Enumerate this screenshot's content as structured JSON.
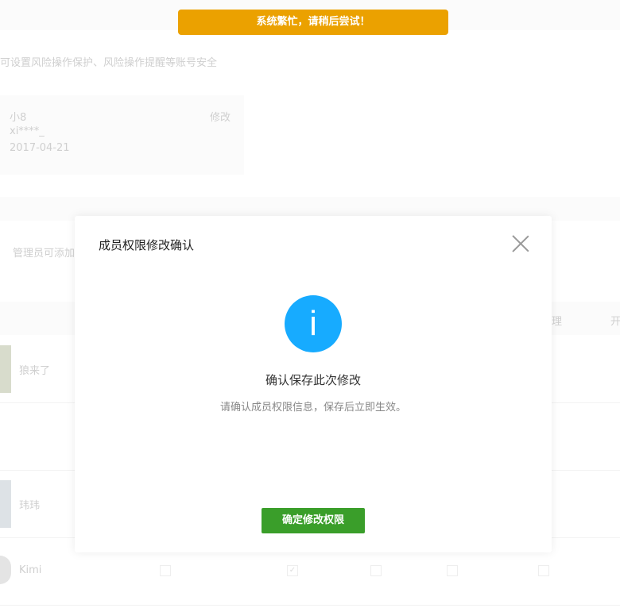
{
  "toast": {
    "message": "系统繁忙，请稍后尝试！",
    "color": "#eba100"
  },
  "background": {
    "security_desc": "可设置风险操作保护、风险操作提醒等账号安全",
    "account_card": {
      "name": "小8",
      "account": "xi****_",
      "date": "2017-04-21",
      "edit_label": "修改"
    },
    "members_desc": "管理员可添加",
    "table_headers": [
      "理",
      "开"
    ],
    "members": [
      {
        "name": "狼来了"
      },
      {
        "name": "玮玮"
      },
      {
        "name": "Kimi",
        "permissions": [
          false,
          true,
          false,
          false,
          false
        ]
      }
    ]
  },
  "modal": {
    "title": "成员权限修改确认",
    "icon": "info-icon",
    "headline": "确认保存此次修改",
    "message": "请确认成员权限信息，保存后立即生效。",
    "confirm_label": "确定修改权限",
    "confirm_color": "#3a9e2a",
    "icon_color": "#17abff"
  }
}
